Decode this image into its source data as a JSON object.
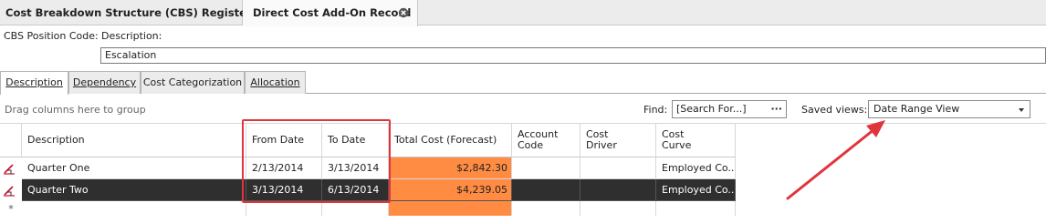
{
  "doc_tabs": [
    {
      "label": "Cost Breakdown Structure (CBS) Register"
    },
    {
      "label": "Direct Cost Add-On Record"
    }
  ],
  "form": {
    "cbs_position_label": "CBS Position Code:",
    "description_label": "Description:",
    "description_value": "Escalation"
  },
  "sub_tabs": [
    {
      "label": "Description",
      "active": true
    },
    {
      "label": "Dependency"
    },
    {
      "label": "Cost Categorization"
    },
    {
      "label": "Allocation"
    }
  ],
  "toolbar": {
    "group_hint": "Drag columns here to group",
    "find_label": "Find:",
    "find_placeholder": "[Search For...]",
    "find_button": "···",
    "saved_views_label": "Saved views:",
    "saved_views_value": "Date Range View"
  },
  "grid": {
    "columns": [
      {
        "key": "description",
        "label": "Description"
      },
      {
        "key": "from_date",
        "label": "From Date"
      },
      {
        "key": "to_date",
        "label": "To Date"
      },
      {
        "key": "total_cost",
        "label": "Total Cost (Forecast)"
      },
      {
        "key": "account_code",
        "label": "Account\nCode"
      },
      {
        "key": "cost_driver",
        "label": "Cost\nDriver"
      },
      {
        "key": "cost_curve",
        "label": "Cost\nCurve"
      }
    ],
    "rows": [
      {
        "description": "Quarter One",
        "from_date": "2/13/2014",
        "to_date": "3/13/2014",
        "total_cost": "$2,842.30",
        "account_code": "",
        "cost_driver": "",
        "cost_curve": "Employed Co...",
        "selected": false
      },
      {
        "description": "Quarter Two",
        "from_date": "3/13/2014",
        "to_date": "6/13/2014",
        "total_cost": "$4,239.05",
        "account_code": "",
        "cost_driver": "",
        "cost_curve": "Employed Co...",
        "selected": true
      }
    ],
    "new_row_marker": "*"
  },
  "colors": {
    "forecast_highlight": "#ff8c42",
    "selected_row": "#2f2f2f",
    "annotation": "#e0353d"
  }
}
